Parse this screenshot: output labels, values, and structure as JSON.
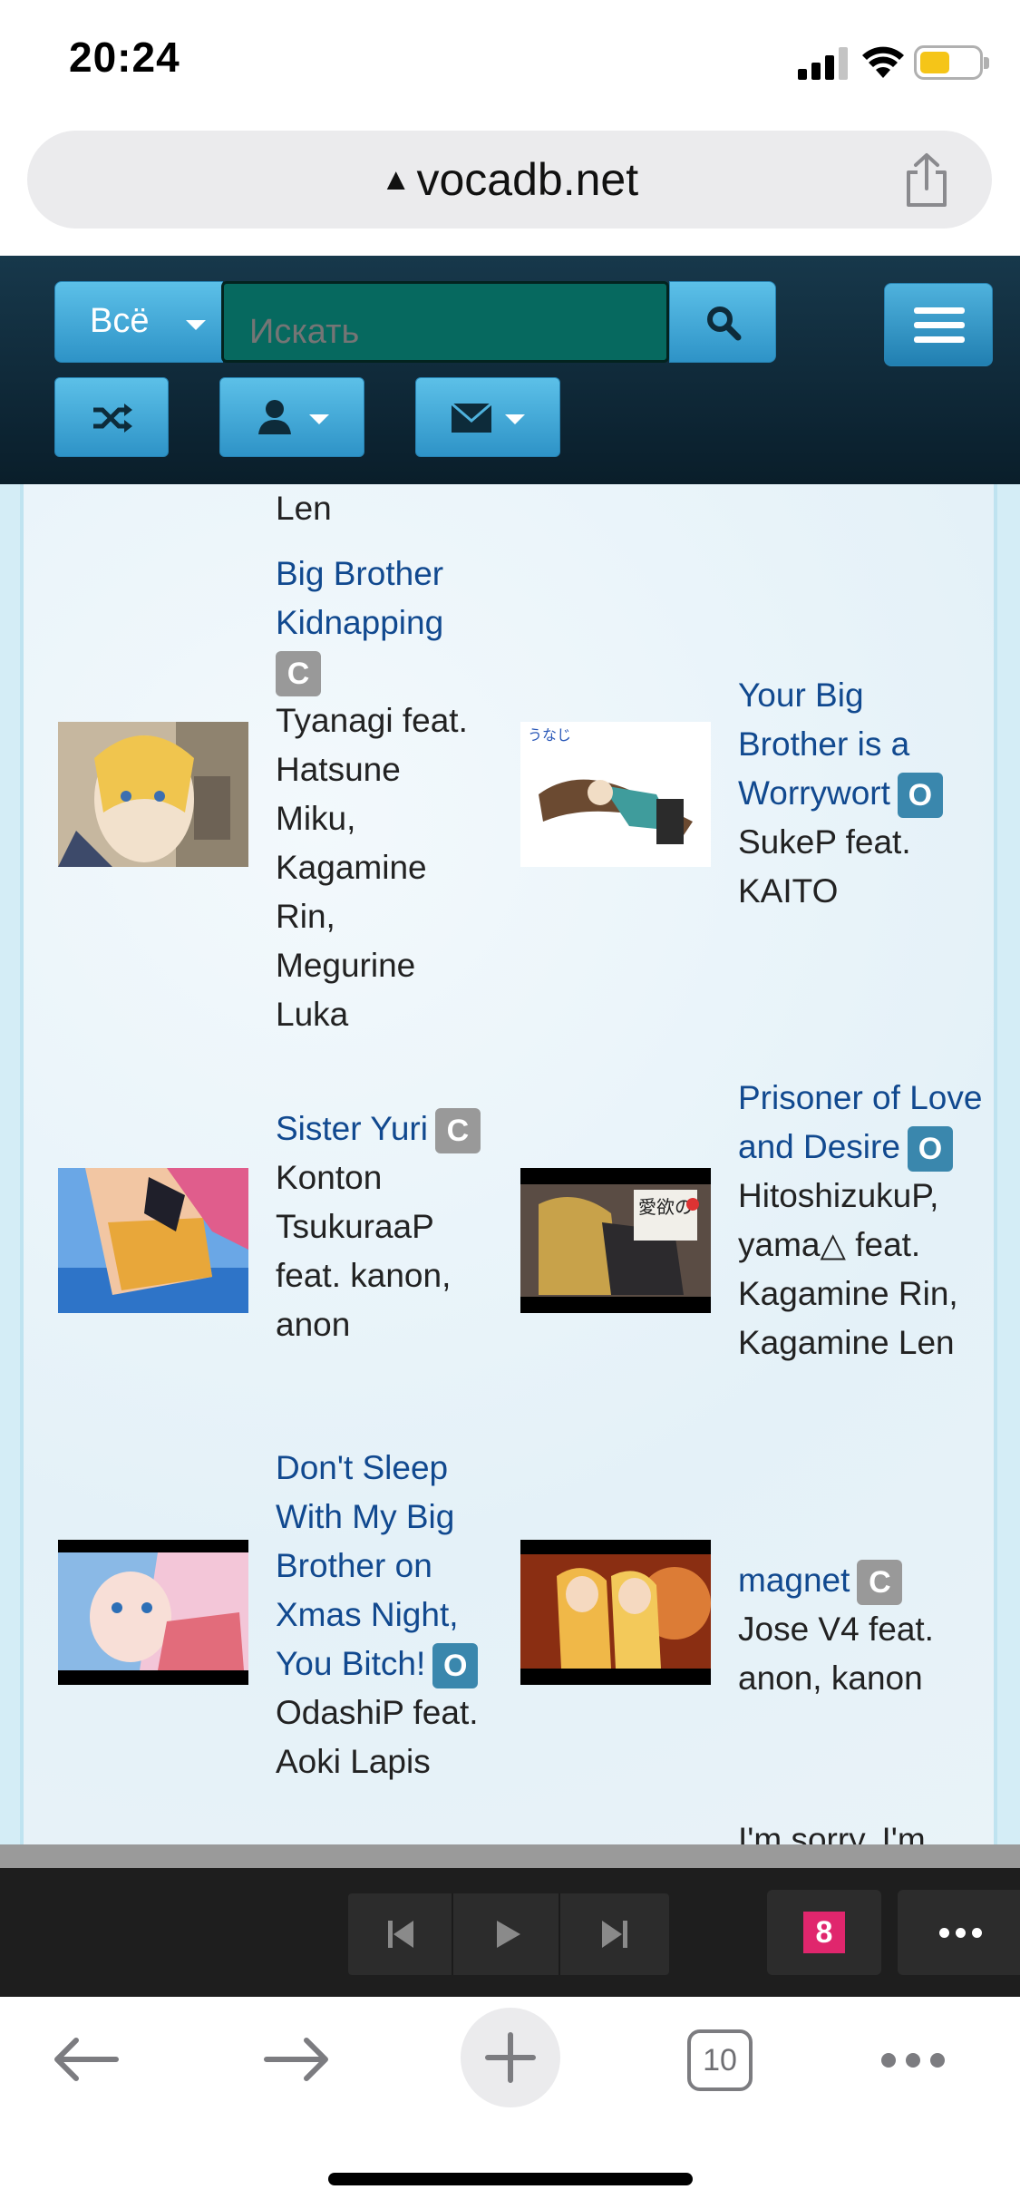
{
  "status_bar": {
    "time": "20:24"
  },
  "browser": {
    "url": "vocadb.net",
    "url_warning": "▲"
  },
  "header": {
    "search_scope": "Всё",
    "search_placeholder": "Искать"
  },
  "content": {
    "top_cutoff_text": "Len",
    "songs": [
      {
        "title": "Big Brother Kidnapping",
        "badge": "C",
        "artists": "Tyanagi feat. Hatsune Miku, Kagamine Rin, Megurine Luka"
      },
      {
        "title": "Your Big Brother is a Worrywort",
        "badge": "O",
        "artists": "SukeP feat. KAITO"
      },
      {
        "title": "Sister Yuri",
        "badge": "C",
        "artists": "Konton TsukuraaP feat. kanon, anon"
      },
      {
        "title": "Prisoner of Love and Desire",
        "badge": "O",
        "artists": "HitoshizukuP, yama△ feat. Kagamine Rin, Kagamine Len"
      },
      {
        "title": "Don't Sleep With My Big Brother on Xmas Night, You Bitch!",
        "badge": "O",
        "artists": "OdashiP feat. Aoki Lapis"
      },
      {
        "title": "magnet",
        "badge": "C",
        "artists": "Jose V4 feat. anon, kanon"
      }
    ],
    "bottom_cutoff_title": "I'm sorry, I'm"
  },
  "thumb_texts": {
    "worrywort": "うなじ",
    "prisoner": "愛欲の"
  },
  "player": {
    "logo_letter": "8"
  },
  "toolbar": {
    "tab_count": "10"
  },
  "colors": {
    "header_bg": "#0c2331",
    "button_blue": "#3ca6d6",
    "search_bg": "#06695f",
    "link": "#11498f",
    "badge_c": "#999999",
    "badge_o": "#3a87ad",
    "player_bg": "#1e1e1e"
  }
}
